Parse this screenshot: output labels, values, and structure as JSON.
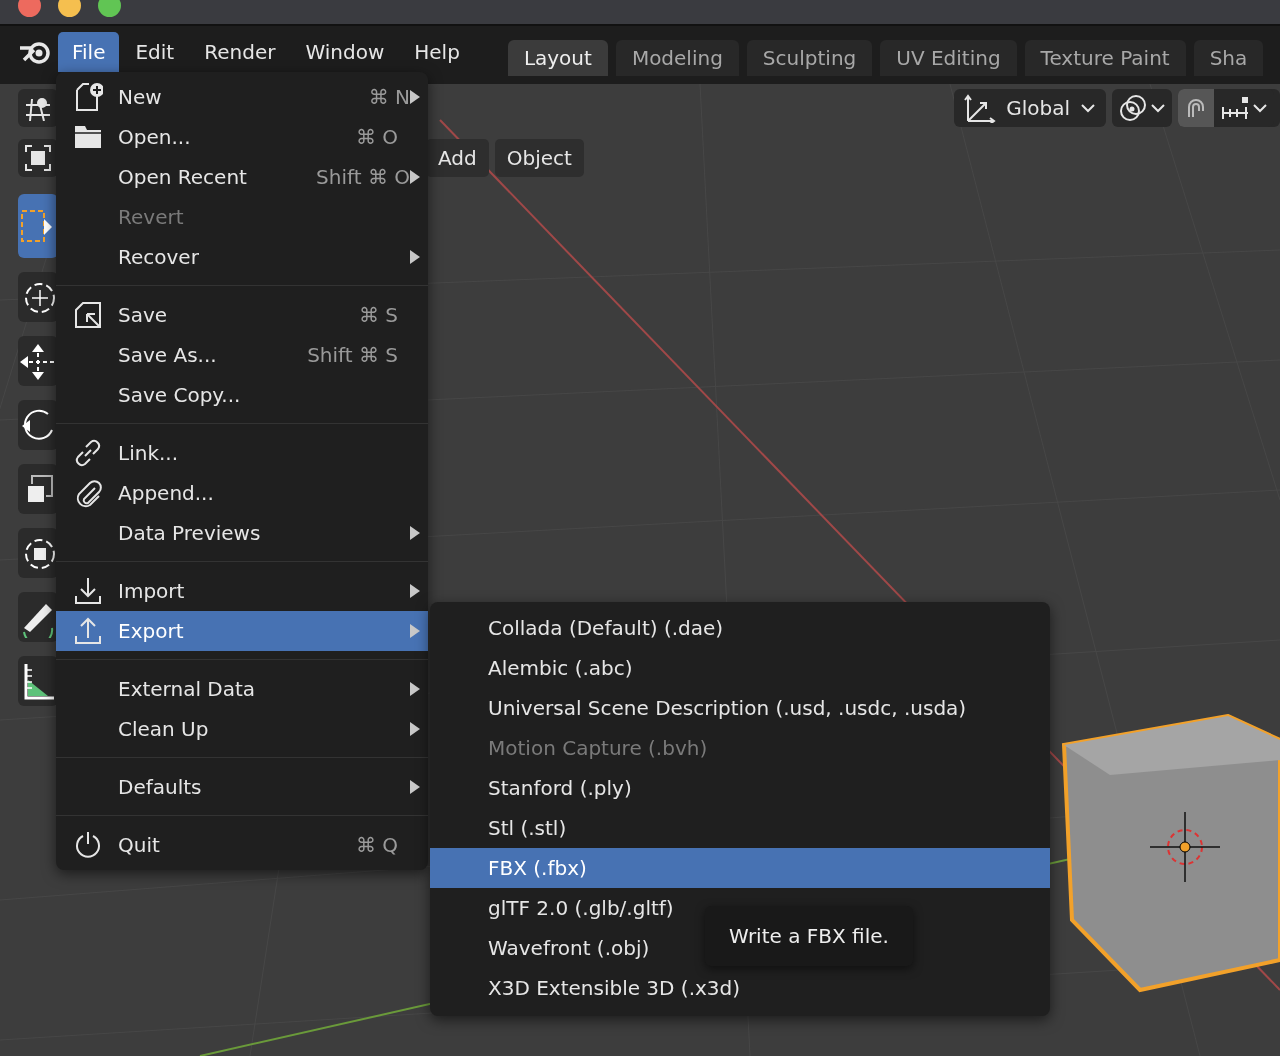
{
  "menubar": [
    {
      "label": "File",
      "selected": true
    },
    {
      "label": "Edit",
      "selected": false
    },
    {
      "label": "Render",
      "selected": false
    },
    {
      "label": "Window",
      "selected": false
    },
    {
      "label": "Help",
      "selected": false
    }
  ],
  "workspace_tabs": [
    {
      "label": "Layout",
      "selected": true
    },
    {
      "label": "Modeling",
      "selected": false
    },
    {
      "label": "Sculpting",
      "selected": false
    },
    {
      "label": "UV Editing",
      "selected": false
    },
    {
      "label": "Texture Paint",
      "selected": false
    },
    {
      "label": "Sha",
      "selected": false
    }
  ],
  "viewport_header": {
    "transform_orientation": "Global",
    "menus": [
      "Add",
      "Object"
    ]
  },
  "file_menu": [
    [
      {
        "label": "New",
        "shortcut": "⌘ N",
        "submenu": true,
        "disabled": false,
        "selected": false
      },
      {
        "label": "Open...",
        "shortcut": "⌘ O",
        "submenu": false,
        "disabled": false,
        "selected": false
      },
      {
        "label": "Open Recent",
        "shortcut": "Shift ⌘ O",
        "submenu": true,
        "disabled": false,
        "selected": false
      },
      {
        "label": "Revert",
        "submenu": false,
        "disabled": true,
        "selected": false
      },
      {
        "label": "Recover",
        "submenu": true,
        "disabled": false,
        "selected": false
      }
    ],
    [
      {
        "label": "Save",
        "shortcut": "⌘ S",
        "submenu": false,
        "disabled": false,
        "selected": false
      },
      {
        "label": "Save As...",
        "shortcut": "Shift ⌘ S",
        "submenu": false,
        "disabled": false,
        "selected": false
      },
      {
        "label": "Save Copy...",
        "submenu": false,
        "disabled": false,
        "selected": false
      }
    ],
    [
      {
        "label": "Link...",
        "submenu": false,
        "disabled": false,
        "selected": false
      },
      {
        "label": "Append...",
        "submenu": false,
        "disabled": false,
        "selected": false
      },
      {
        "label": "Data Previews",
        "submenu": true,
        "disabled": false,
        "selected": false
      }
    ],
    [
      {
        "label": "Import",
        "submenu": true,
        "disabled": false,
        "selected": false
      },
      {
        "label": "Export",
        "submenu": true,
        "disabled": false,
        "selected": true
      }
    ],
    [
      {
        "label": "External Data",
        "submenu": true,
        "disabled": false,
        "selected": false
      },
      {
        "label": "Clean Up",
        "submenu": true,
        "disabled": false,
        "selected": false
      }
    ],
    [
      {
        "label": "Defaults",
        "submenu": true,
        "disabled": false,
        "selected": false
      }
    ],
    [
      {
        "label": "Quit",
        "shortcut": "⌘ Q",
        "submenu": false,
        "disabled": false,
        "selected": false
      }
    ]
  ],
  "export_menu": [
    {
      "label": "Collada (Default) (.dae)",
      "disabled": false,
      "selected": false
    },
    {
      "label": "Alembic (.abc)",
      "disabled": false,
      "selected": false
    },
    {
      "label": "Universal Scene Description (.usd, .usdc, .usda)",
      "disabled": false,
      "selected": false
    },
    {
      "label": "Motion Capture (.bvh)",
      "disabled": true,
      "selected": false
    },
    {
      "label": "Stanford (.ply)",
      "disabled": false,
      "selected": false
    },
    {
      "label": "Stl (.stl)",
      "disabled": false,
      "selected": false
    },
    {
      "label": "FBX (.fbx)",
      "disabled": false,
      "selected": true
    },
    {
      "label": "glTF 2.0 (.glb/.gltf)",
      "disabled": false,
      "selected": false
    },
    {
      "label": "Wavefront (.obj)",
      "disabled": false,
      "selected": false
    },
    {
      "label": "X3D Extensible 3D (.x3d)",
      "disabled": false,
      "selected": false
    }
  ],
  "tooltip": "Write a FBX file."
}
